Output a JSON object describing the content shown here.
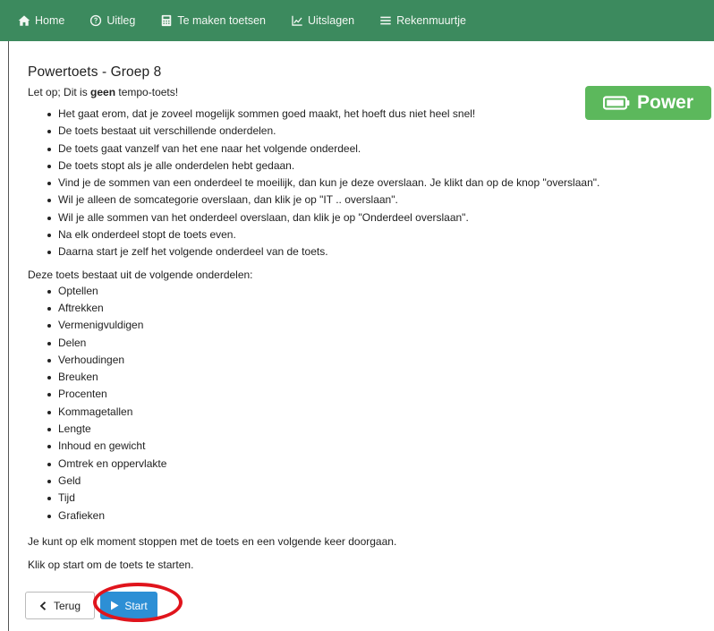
{
  "nav": {
    "items": [
      {
        "label": "Home",
        "icon": "home-icon"
      },
      {
        "label": "Uitleg",
        "icon": "question-circle-icon"
      },
      {
        "label": "Te maken toetsen",
        "icon": "calculator-icon"
      },
      {
        "label": "Uitslagen",
        "icon": "chart-line-icon"
      },
      {
        "label": "Rekenmuurtje",
        "icon": "bars-icon"
      }
    ],
    "bg_color": "#3c8a5e"
  },
  "page": {
    "title": "Powertoets - Groep 8",
    "intro_prefix": "Let op; Dit is ",
    "intro_bold": "geen",
    "intro_suffix": " tempo-toets!",
    "badge": {
      "label": "Power",
      "icon": "battery-icon",
      "color": "#5cb85c"
    },
    "rules": [
      "Het gaat erom, dat je zoveel mogelijk sommen goed maakt, het hoeft dus niet heel snel!",
      "De toets bestaat uit verschillende onderdelen.",
      "De toets gaat vanzelf van het ene naar het volgende onderdeel.",
      "De toets stopt als je alle onderdelen hebt gedaan.",
      "Vind je de sommen van een onderdeel te moeilijk, dan kun je deze overslaan. Je klikt dan op de knop \"overslaan\".",
      "Wil je alleen de somcategorie overslaan, dan klik je op \"IT .. overslaan\".",
      "Wil je alle sommen van het onderdeel overslaan, dan klik je op \"Onderdeel overslaan\".",
      "Na elk onderdeel stopt de toets even.",
      "Daarna start je zelf het volgende onderdeel van de toets."
    ],
    "parts_label": "Deze toets bestaat uit de volgende onderdelen:",
    "parts": [
      "Optellen",
      "Aftrekken",
      "Vermenigvuldigen",
      "Delen",
      "Verhoudingen",
      "Breuken",
      "Procenten",
      "Kommagetallen",
      "Lengte",
      "Inhoud en gewicht",
      "Omtrek en oppervlakte",
      "Geld",
      "Tijd",
      "Grafieken"
    ],
    "stop_note": "Je kunt op elk moment stoppen met de toets en een volgende keer doorgaan.",
    "start_note": "Klik op start om de toets te starten."
  },
  "buttons": {
    "back_label": "Terug",
    "start_label": "Start",
    "start_color": "#2d8fd5",
    "highlight_color": "#e0141c"
  }
}
